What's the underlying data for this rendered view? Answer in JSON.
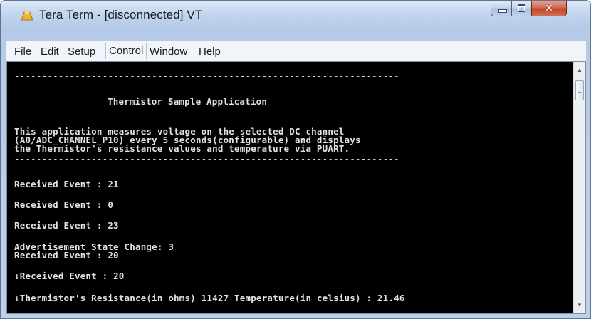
{
  "window": {
    "title": "Tera Term - [disconnected] VT"
  },
  "icons": {
    "app": "teraterm-app-icon",
    "minimize": "minimize-icon",
    "maximize": "maximize-icon",
    "close": "close-icon",
    "scroll_up": "scroll-up-arrow-icon",
    "scroll_down": "scroll-down-arrow-icon"
  },
  "colors": {
    "terminal_bg": "#000000",
    "terminal_fg": "#e2e2e2",
    "close_button": "#c2452b",
    "titlebar": "#c1d5ee"
  },
  "menu": {
    "items": [
      {
        "label": "File"
      },
      {
        "label": "Edit"
      },
      {
        "label": "Setup"
      },
      {
        "label": "Control"
      },
      {
        "label": "Window"
      },
      {
        "label": "Help"
      }
    ]
  },
  "terminal": {
    "lines": [
      "----------------------------------------------------------------------",
      "Thermistor Sample Application",
      "----------------------------------------------------------------------",
      "This application measures voltage on the selected DC channel",
      "(A0/ADC_CHANNEL_P10) every 5 seconds(configurable) and displays",
      "the Thermistor's resistance values and temperature via PUART.",
      "----------------------------------------------------------------------",
      "Received Event : 21",
      "Received Event : 0",
      "Received Event : 23",
      "Advertisement State Change: 3",
      "Received Event : 20",
      "↓Received Event : 20",
      "↓Thermistor's Resistance(in ohms) 11427 Temperature(in celsius) : 21.46"
    ]
  }
}
